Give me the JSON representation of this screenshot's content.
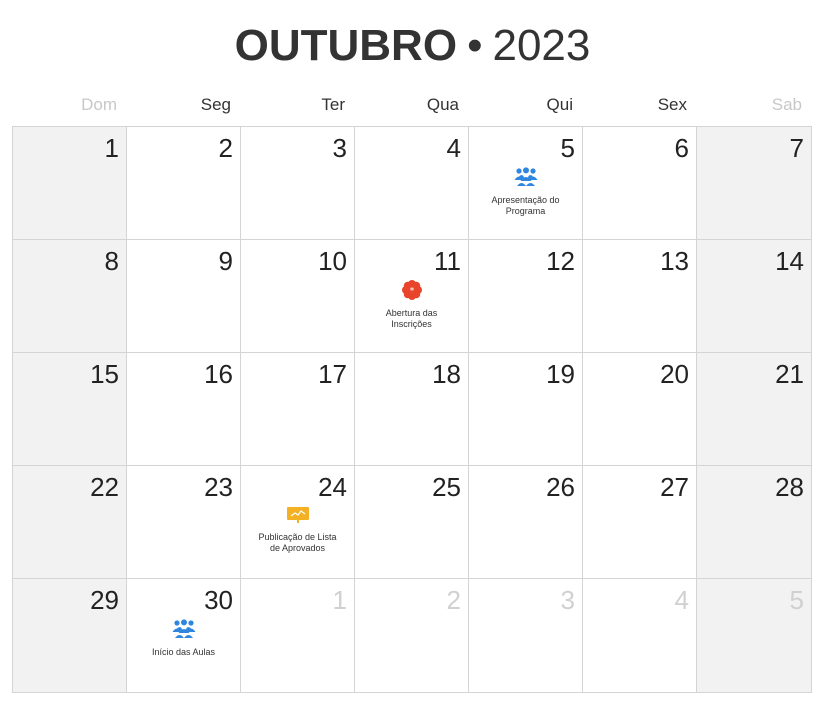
{
  "header": {
    "month": "OUTUBRO",
    "separator": "•",
    "year": "2023"
  },
  "weekdays": [
    "Dom",
    "Seg",
    "Ter",
    "Qua",
    "Qui",
    "Sex",
    "Sab"
  ],
  "weeks": [
    [
      {
        "day": "1",
        "weekend": true
      },
      {
        "day": "2"
      },
      {
        "day": "3"
      },
      {
        "day": "4"
      },
      {
        "day": "5",
        "event": {
          "label": "Apresentação do Programa",
          "icon": "people-group-icon",
          "color": "#2e86de"
        }
      },
      {
        "day": "6"
      },
      {
        "day": "7",
        "weekend": true
      }
    ],
    [
      {
        "day": "8",
        "weekend": true
      },
      {
        "day": "9"
      },
      {
        "day": "10"
      },
      {
        "day": "11",
        "event": {
          "label": "Abertura das Inscrições",
          "icon": "flower-badge-icon",
          "color": "#e8452c"
        }
      },
      {
        "day": "12"
      },
      {
        "day": "13"
      },
      {
        "day": "14",
        "weekend": true
      }
    ],
    [
      {
        "day": "15",
        "weekend": true
      },
      {
        "day": "16"
      },
      {
        "day": "17"
      },
      {
        "day": "18"
      },
      {
        "day": "19"
      },
      {
        "day": "20"
      },
      {
        "day": "21",
        "weekend": true
      }
    ],
    [
      {
        "day": "22",
        "weekend": true
      },
      {
        "day": "23"
      },
      {
        "day": "24",
        "event": {
          "label": "Publicação de Lista de Aprovados",
          "icon": "presentation-board-icon",
          "color": "#f4b124"
        }
      },
      {
        "day": "25"
      },
      {
        "day": "26"
      },
      {
        "day": "27"
      },
      {
        "day": "28",
        "weekend": true
      }
    ],
    [
      {
        "day": "29",
        "weekend": true
      },
      {
        "day": "30",
        "event": {
          "label": "Início das Aulas",
          "icon": "people-group-icon",
          "color": "#2e86de"
        }
      },
      {
        "day": "1",
        "other": true
      },
      {
        "day": "2",
        "other": true
      },
      {
        "day": "3",
        "other": true
      },
      {
        "day": "4",
        "other": true
      },
      {
        "day": "5",
        "other": true,
        "weekend": true
      }
    ]
  ]
}
